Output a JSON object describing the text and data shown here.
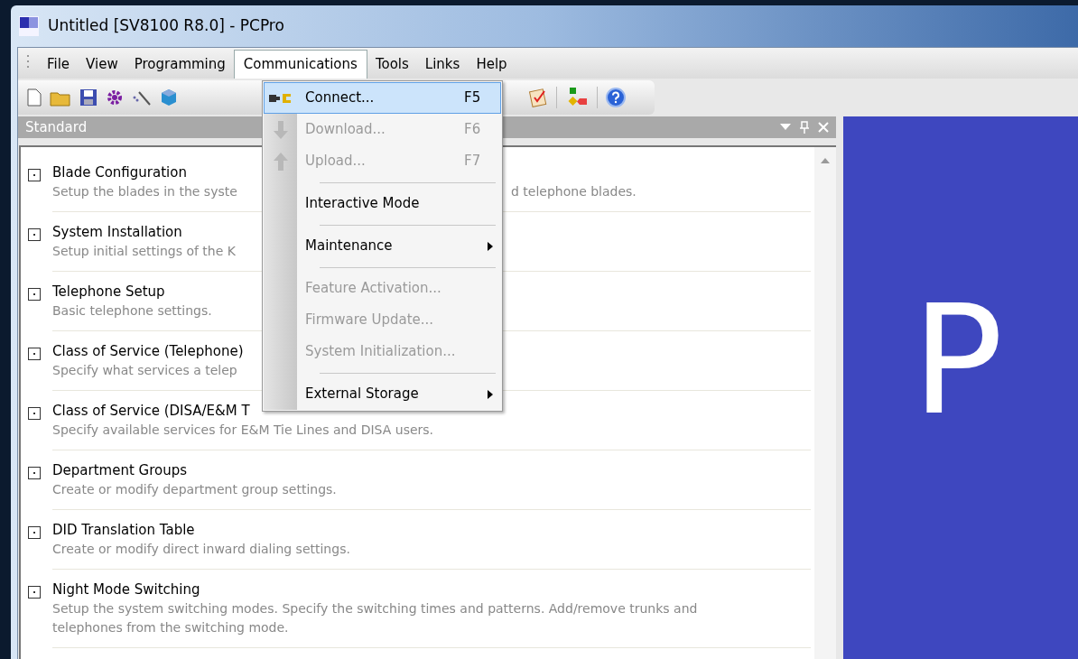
{
  "window": {
    "title": "Untitled [SV8100 R8.0] - PCPro"
  },
  "menu_bar": [
    {
      "label": "File",
      "selected": false
    },
    {
      "label": "View",
      "selected": false
    },
    {
      "label": "Programming",
      "selected": false
    },
    {
      "label": "Communications",
      "selected": true
    },
    {
      "label": "Tools",
      "selected": false
    },
    {
      "label": "Links",
      "selected": false
    },
    {
      "label": "Help",
      "selected": false
    }
  ],
  "communications_menu": [
    {
      "kind": "item",
      "label": "Connect...",
      "shortcut": "F5",
      "disabled": false,
      "selected": true,
      "submenu": false
    },
    {
      "kind": "item",
      "label": "Download...",
      "shortcut": "F6",
      "disabled": true,
      "selected": false,
      "submenu": false
    },
    {
      "kind": "item",
      "label": "Upload...",
      "shortcut": "F7",
      "disabled": true,
      "selected": false,
      "submenu": false
    },
    {
      "kind": "separator"
    },
    {
      "kind": "item",
      "label": "Interactive Mode",
      "disabled": false,
      "selected": false,
      "submenu": false
    },
    {
      "kind": "separator"
    },
    {
      "kind": "item",
      "label": "Maintenance",
      "disabled": false,
      "selected": false,
      "submenu": true
    },
    {
      "kind": "separator"
    },
    {
      "kind": "item",
      "label": "Feature Activation...",
      "disabled": true,
      "selected": false,
      "submenu": false
    },
    {
      "kind": "item",
      "label": "Firmware Update...",
      "disabled": true,
      "selected": false,
      "submenu": false
    },
    {
      "kind": "item",
      "label": "System Initialization...",
      "disabled": true,
      "selected": false,
      "submenu": false
    },
    {
      "kind": "separator"
    },
    {
      "kind": "item",
      "label": "External Storage",
      "disabled": false,
      "selected": false,
      "submenu": true
    }
  ],
  "panel": {
    "title": "Standard"
  },
  "items": [
    {
      "title": "Blade Configuration",
      "description": "Setup the blades in the syste",
      "description_right": "d telephone blades."
    },
    {
      "title": "System Installation",
      "description": "Setup initial settings of the K"
    },
    {
      "title": "Telephone Setup",
      "description": "Basic telephone settings."
    },
    {
      "title": "Class of Service (Telephone)",
      "description": "Specify what services a telep"
    },
    {
      "title": "Class of Service (DISA/E&M T",
      "description": "Specify available services for E&M Tie Lines and DISA users."
    },
    {
      "title": "Department Groups",
      "description": "Create or modify department group settings."
    },
    {
      "title": "DID Translation Table",
      "description": "Create or modify direct inward dialing settings."
    },
    {
      "title": "Night Mode Switching",
      "description": "Setup the system switching modes. Specify the switching times and patterns. Add/remove trunks and telephones from the switching mode."
    }
  ],
  "splash": {
    "text": "P"
  }
}
